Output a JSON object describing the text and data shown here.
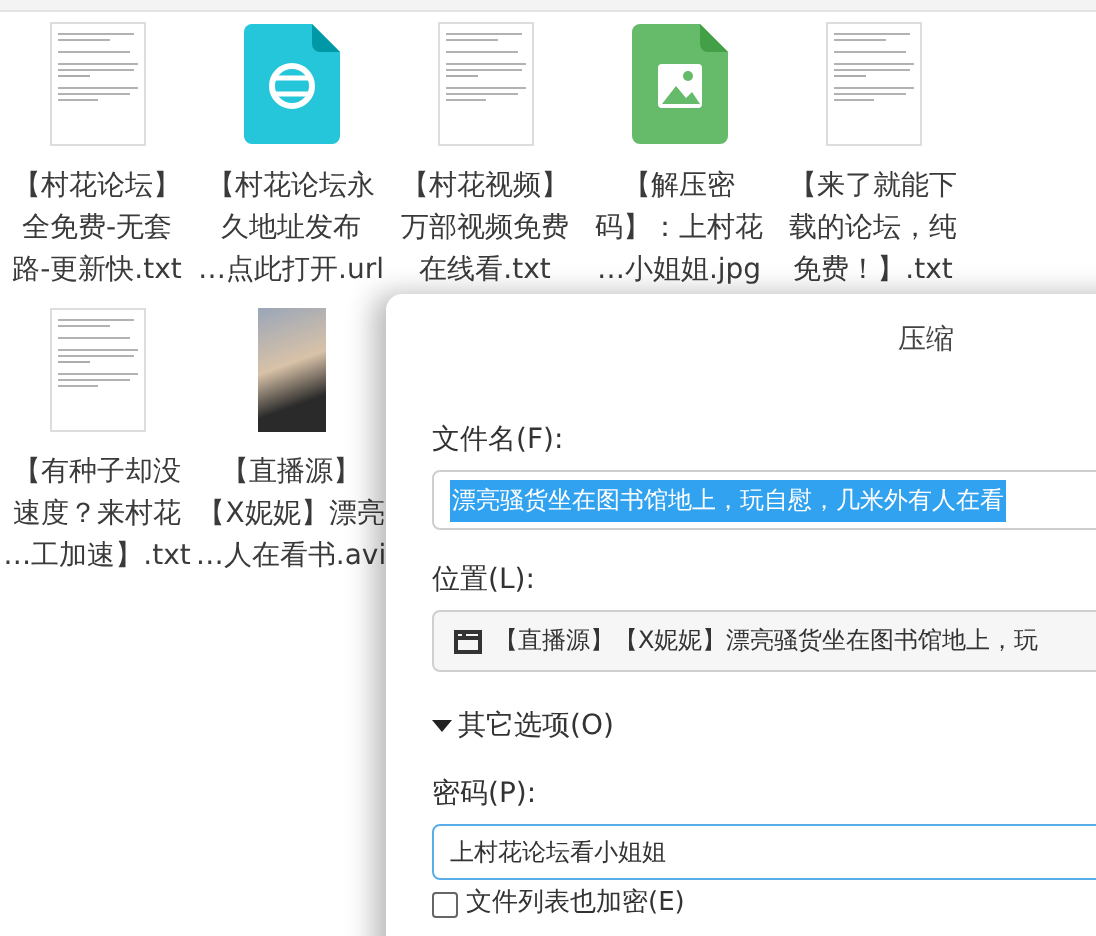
{
  "files": [
    {
      "kind": "text",
      "lines": [
        "【村花论坛】",
        "全免费-无套",
        "路-更新快.txt"
      ]
    },
    {
      "kind": "link",
      "lines": [
        "【村花论坛永",
        "久地址发布",
        "…点此打开.url"
      ]
    },
    {
      "kind": "text",
      "lines": [
        "【村花视频】",
        "万部视频免费",
        "在线看.txt"
      ]
    },
    {
      "kind": "image",
      "lines": [
        "【解压密",
        "码】：上村花",
        "…小姐姐.jpg"
      ]
    },
    {
      "kind": "text",
      "lines": [
        "【来了就能下",
        "载的论坛，纯",
        "免费！】.txt"
      ]
    },
    {
      "kind": "text",
      "lines": [
        "【有种子却没",
        "速度？来村花",
        "…工加速】.txt"
      ]
    },
    {
      "kind": "video",
      "lines": [
        "【直播源】",
        "【X妮妮】漂亮",
        "…人在看书.avi"
      ]
    }
  ],
  "dialog": {
    "title": "压缩",
    "filename": {
      "label": "文件名(F):",
      "value": "漂亮骚货坐在图书馆地上，玩自慰，几米外有人在看",
      "selected": true
    },
    "location": {
      "label": "位置(L):",
      "value": "【直播源】【X妮妮】漂亮骚货坐在图书馆地上，玩"
    },
    "options": {
      "label": "其它选项(O)",
      "expanded": true
    },
    "password": {
      "label": "密码(P):",
      "value": "上村花论坛看小姐姐"
    },
    "encrypt_list": {
      "label": "文件列表也加密(E)",
      "checked": false
    }
  }
}
